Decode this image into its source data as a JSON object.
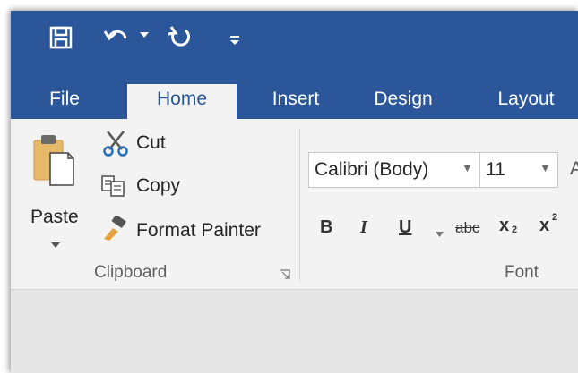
{
  "quick_access": {
    "save": "save-icon",
    "undo": "undo-icon",
    "undo_more": "dropdown-arrow-icon",
    "redo": "redo-icon",
    "customize": "customize-qat-icon"
  },
  "tabs": [
    {
      "label": "File",
      "active": false
    },
    {
      "label": "Home",
      "active": true
    },
    {
      "label": "Insert",
      "active": false
    },
    {
      "label": "Design",
      "active": false
    },
    {
      "label": "Layout",
      "active": false
    }
  ],
  "clipboard": {
    "paste_label": "Paste",
    "cut_label": "Cut",
    "copy_label": "Copy",
    "format_painter_label": "Format Painter",
    "group_label": "Clipboard"
  },
  "font": {
    "font_name": "Calibri (Body)",
    "font_size": "11",
    "bold": "B",
    "italic": "I",
    "underline": "U",
    "strikethrough": "abc",
    "subscript": "x",
    "subscript_mark": "2",
    "superscript": "x",
    "superscript_mark": "2",
    "grow_partial": "A",
    "group_label": "Font"
  },
  "colors": {
    "title_bar": "#2b579a",
    "ribbon": "#f3f3f3",
    "document_area": "#e6e6e6"
  }
}
